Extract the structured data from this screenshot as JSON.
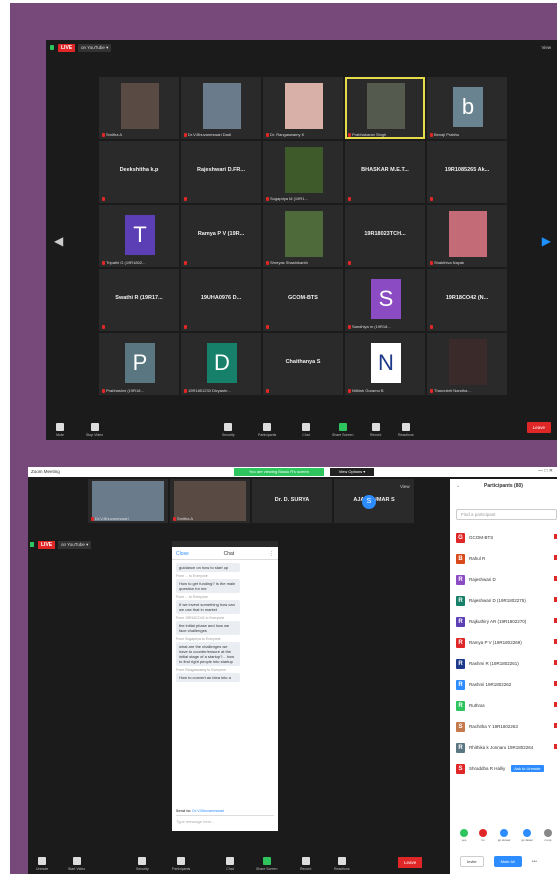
{
  "top_window": {
    "live": "LIVE",
    "youtube": "on YouTube ▾",
    "view": "View",
    "tiles": [
      {
        "kind": "video",
        "name": "Smitha A",
        "color": "#5a4a44"
      },
      {
        "kind": "video",
        "name": "Dr.V.Bhuvaneswari Dadi",
        "color": "#6a7b8c"
      },
      {
        "kind": "video",
        "name": "Dr. Rangaswamy K",
        "color": "#d9b0a8"
      },
      {
        "kind": "video",
        "name": "Prabhakaran Singh",
        "color": "#555a4e",
        "speaking": true
      },
      {
        "kind": "letter",
        "name": "Benaji Prabhu",
        "letter": "b",
        "color": "#6a8391"
      },
      {
        "kind": "name",
        "big": "Deekshitha k.p"
      },
      {
        "kind": "name",
        "big": "Rajeshwari D.FR..."
      },
      {
        "kind": "video",
        "name": "Sugapriya M (19R1...",
        "color": "#3e5a2a"
      },
      {
        "kind": "name",
        "big": "BHASKAR M.E.T..."
      },
      {
        "kind": "name",
        "big": "19R1085265 Ak..."
      },
      {
        "kind": "letter",
        "name": "Tripathi G (19R1802...",
        "letter": "T",
        "color": "#5d3fb5"
      },
      {
        "kind": "name",
        "big": "Ramya P V (19R..."
      },
      {
        "kind": "video",
        "name": "Shreyas Shashikanth",
        "color": "#4e6a3a"
      },
      {
        "kind": "name",
        "big": "19R18023TCH..."
      },
      {
        "kind": "video",
        "name": "Shakthiva Nayak",
        "color": "#c46b78"
      },
      {
        "kind": "name",
        "big": "Swathi R (19R17..."
      },
      {
        "kind": "name",
        "big": "19UHA0976 D..."
      },
      {
        "kind": "name",
        "big": "GCOM-BTS"
      },
      {
        "kind": "letter",
        "name": "Sandhiya m (19R18...",
        "letter": "S",
        "color": "#8b4bc2"
      },
      {
        "kind": "name",
        "big": "19R18CO42 (N..."
      },
      {
        "kind": "letter",
        "name": "Prabhashni (19R18...",
        "letter": "P",
        "color": "#5a7680"
      },
      {
        "kind": "letter",
        "name": "19R1851233 Divyashr...",
        "letter": "D",
        "color": "#16806a"
      },
      {
        "kind": "name",
        "big": "Chaithanya S"
      },
      {
        "kind": "letter",
        "name": "Nithish Guramu B",
        "letter": "N",
        "color": "#ffffff",
        "fg": "#1e3a8a"
      },
      {
        "kind": "video",
        "name": "Tharunbrit Nandha...",
        "color": "#3a2a2a"
      }
    ],
    "toolbar": {
      "mute": "Mute",
      "video": "Stop Video",
      "security": "Security",
      "participants": "Participants",
      "participants_count": "80",
      "chat": "Chat",
      "share": "Share Screen",
      "record": "Record",
      "reactions": "Reactions",
      "end": "Leave"
    }
  },
  "bottom_window": {
    "title": "Zoom Meeting",
    "green_banner": "You are viewing Biosiu R's screen",
    "view_options": "View Options ▾",
    "view": "View",
    "live": "LIVE",
    "youtube": "on YouTube ▾",
    "strip": [
      {
        "kind": "video",
        "name": "Dr.V.Bhuvaneswari",
        "color": "#6a7b8c"
      },
      {
        "kind": "video",
        "name": "Smitha A",
        "color": "#5a4a44"
      },
      {
        "kind": "name",
        "big": "Dr. D. SURYA"
      },
      {
        "kind": "name",
        "big": "AJAY KUMAR S"
      }
    ],
    "strip_badge": "S",
    "chat": {
      "close": "Close",
      "title": "Chat",
      "messages": [
        {
          "meta": "",
          "text": "guidance on how to start up"
        },
        {
          "meta": "From ... to Everyone",
          "text": "How to get funding? Is the main question for me"
        },
        {
          "meta": "From ... to Everyone",
          "text": "If we invent something how can we use that in market"
        },
        {
          "meta": "From 19R18CO42 to Everyone",
          "text": "the initial phase and how we face challenges"
        },
        {
          "meta": "From Sugapriya to Everyone",
          "text": "what are the challenges we have to counter/ensure at the initial stage of a startup?... how to find right people into startup"
        },
        {
          "meta": "From Rangaswamy to Everyone",
          "text": "How to convert an idea into a"
        }
      ],
      "send_to_label": "Send to:",
      "send_to": "Dr.V.Bhuvaneswari",
      "input_placeholder": "Type message here..."
    },
    "toolbar": {
      "unmute": "Unmute",
      "video": "Start Video",
      "security": "Security",
      "participants": "Participants",
      "participants_count": "80",
      "chat": "Chat",
      "share": "Share Screen",
      "record": "Record",
      "reactions": "Reactions",
      "end": "Leave"
    },
    "participants_panel": {
      "title": "Participants (80)",
      "search_placeholder": "Find a participant",
      "ask_unmute": "Ask to Unmute",
      "list": [
        {
          "initial": "G",
          "name": "GCOM-BTS",
          "color": "#e02727"
        },
        {
          "initial": "B",
          "name": "Rahul R",
          "color": "#d84a1b"
        },
        {
          "initial": "R",
          "name": "Rajeshwari D",
          "color": "#8b4bc2"
        },
        {
          "initial": "R",
          "name": "Rajeshwari D (19R1802275)",
          "color": "#16806a"
        },
        {
          "initial": "R",
          "name": "Rajkuthiry AR (19R1802270)",
          "color": "#5d3fb5"
        },
        {
          "initial": "R",
          "name": "Ramya P V (19R1802269)",
          "color": "#e02727"
        },
        {
          "initial": "R",
          "name": "Rashmi R (19R1802261)",
          "color": "#1e3a8a"
        },
        {
          "initial": "R",
          "name": "Rashmi 19R1802262",
          "color": "#2d8cff"
        },
        {
          "initial": "R",
          "name": "Ruthras",
          "color": "#2ec45e"
        },
        {
          "initial": "S",
          "name": "Rachitha Y 19R1802263",
          "color": "#c47a4a"
        },
        {
          "initial": "R",
          "name": "Rhithika k Jonnaru 19R1802264",
          "color": "#5a7680"
        },
        {
          "initial": "S",
          "name": "Shraddha R Halliy",
          "color": "#e02727"
        }
      ],
      "reactions": [
        {
          "label": "yes",
          "color": "#2ec45e"
        },
        {
          "label": "no",
          "color": "#e02727"
        },
        {
          "label": "go slower",
          "color": "#2d8cff"
        },
        {
          "label": "go faster",
          "color": "#2d8cff"
        },
        {
          "label": "more",
          "color": "#888"
        }
      ],
      "invite": "Invite",
      "mute_all": "Mute All"
    }
  }
}
